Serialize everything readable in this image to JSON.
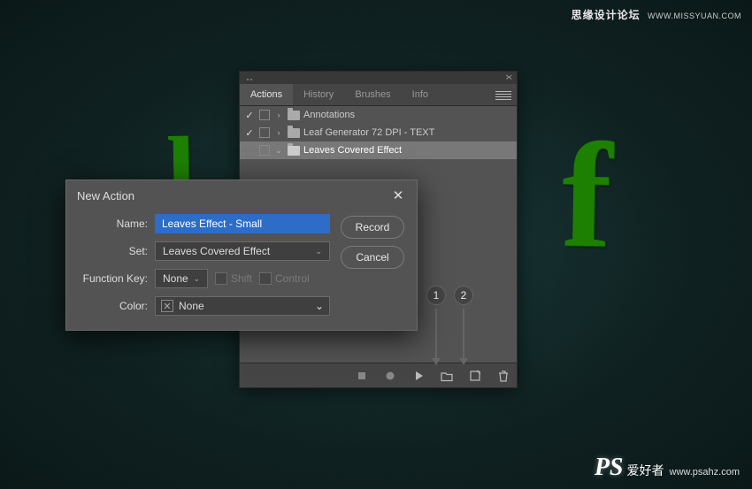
{
  "watermark": {
    "top_text": "思缘设计论坛",
    "top_url": "WWW.MISSYUAN.COM",
    "ps": "PS",
    "ps_ch": "爱好者",
    "ps_url": "www.psahz.com"
  },
  "leaf": {
    "l": "l",
    "f": "f"
  },
  "panel": {
    "tabs": {
      "actions": "Actions",
      "history": "History",
      "brushes": "Brushes",
      "info": "Info"
    },
    "rows": [
      {
        "checked": true,
        "expand": "›",
        "label": "Annotations"
      },
      {
        "checked": true,
        "expand": "›",
        "label": "Leaf Generator 72 DPI - TEXT"
      },
      {
        "checked": false,
        "expand": "⌄",
        "label": "Leaves Covered Effect",
        "selected": true
      }
    ]
  },
  "markers": {
    "m1": "1",
    "m2": "2"
  },
  "dialog": {
    "title": "New Action",
    "name_label": "Name:",
    "name_value": "Leaves Effect - Small",
    "set_label": "Set:",
    "set_value": "Leaves Covered Effect",
    "fkey_label": "Function Key:",
    "fkey_value": "None",
    "shift": "Shift",
    "control": "Control",
    "color_label": "Color:",
    "color_value": "None",
    "record": "Record",
    "cancel": "Cancel"
  }
}
